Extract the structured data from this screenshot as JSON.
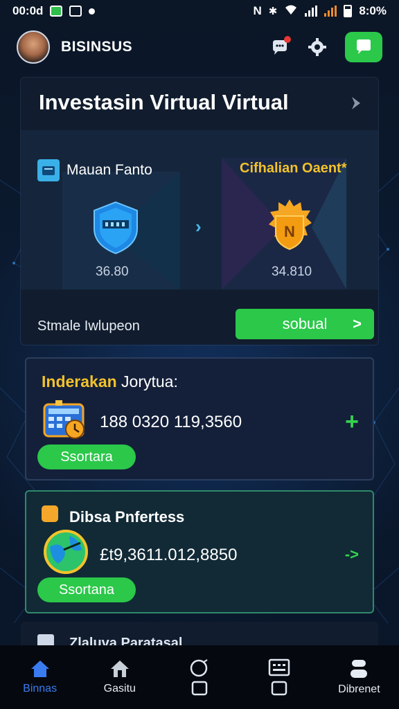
{
  "status_bar": {
    "time": "00:0d",
    "battery_text": "8:0%"
  },
  "header": {
    "brand": "BISINSUS",
    "icons": [
      "avatar",
      "bell-icon",
      "gear-icon",
      "chat-icon"
    ]
  },
  "main_card": {
    "title": "Investasin Virtual Virtual",
    "from_asset": {
      "label": "Mauan Fanto",
      "value": "36.80"
    },
    "to_asset": {
      "label": "Cifhalian Oaent*",
      "value": "34.810"
    },
    "footer_label": "Stmale Iwlupeon",
    "action_label": "sobual",
    "action_arrow": ">"
  },
  "card2": {
    "title_highlight": "Inderakan",
    "title_rest": "Jorytua:",
    "value": "188 0320 119,3560",
    "button_label": "Ssortara",
    "action_symbol": "+"
  },
  "card3": {
    "title": "Dibsa Pnfertess",
    "value": "£t9,3611.012,8850",
    "button_label": "Ssortana",
    "action_symbol": "->"
  },
  "card4": {
    "title": "Zlaluva Paratasal"
  },
  "bottom_nav": [
    {
      "label": "Binnas",
      "icon": "home-icon",
      "active": true
    },
    {
      "label": "Gasitu",
      "icon": "house-icon",
      "active": false
    },
    {
      "label": "",
      "icon": "token-icon",
      "active": false
    },
    {
      "label": "",
      "icon": "calculator-icon",
      "active": false
    },
    {
      "label": "Dibrenet",
      "icon": "profile-icon",
      "active": false
    }
  ],
  "colors": {
    "accent_green": "#2bc84a",
    "accent_yellow": "#f3c22b",
    "background": "#0a1424",
    "card": "#111d2e"
  }
}
